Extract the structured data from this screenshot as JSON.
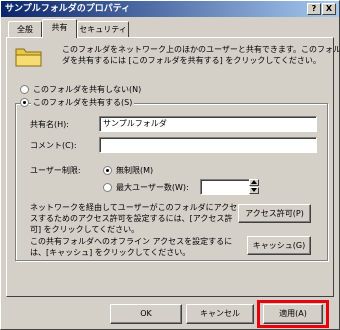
{
  "window": {
    "title": "サンプルフォルダのプロパティ",
    "help_btn": "?",
    "close_btn": "X"
  },
  "tabs": [
    {
      "label": "全般"
    },
    {
      "label": "共有"
    },
    {
      "label": "セキュリティ"
    }
  ],
  "share": {
    "description_line1": "このフォルダをネットワーク上のほかのユーザーと共有できます。このフォル",
    "description_line2": "ダを共有するには [このフォルダを共有する] をクリックしてください。",
    "radio_no_share": "このフォルダを共有しない(N)",
    "radio_share": "このフォルダを共有する(S)",
    "share_name_label": "共有名(H):",
    "share_name_value": "サンプルフォルダ",
    "comment_label": "コメント(C):",
    "comment_value": "",
    "user_limit_label": "ユーザー制限:",
    "unlimited_label": "無制限(M)",
    "max_users_label": "最大ユーザー数(W):",
    "max_users_value": "",
    "perm_text_line1": "ネットワークを経由してユーザーがこのフォルダにアクセ",
    "perm_text_line2": "スするためのアクセス許可を設定するには、[アクセス許",
    "perm_text_line3": "可] をクリックしてください。",
    "perm_button": "アクセス許可(P)",
    "cache_text_line1": "この共有フォルダへのオフライン アクセスを設定するに",
    "cache_text_line2": "は、[キャッシュ] をクリックしてください。",
    "cache_button": "キャッシュ(G)"
  },
  "footer": {
    "ok": "OK",
    "cancel": "キャンセル",
    "apply": "適用(A)"
  },
  "colors": {
    "titlebar_start": "#0a246a",
    "titlebar_end": "#a6caf0",
    "highlight": "#e8000b",
    "face": "#d4d0c8"
  }
}
